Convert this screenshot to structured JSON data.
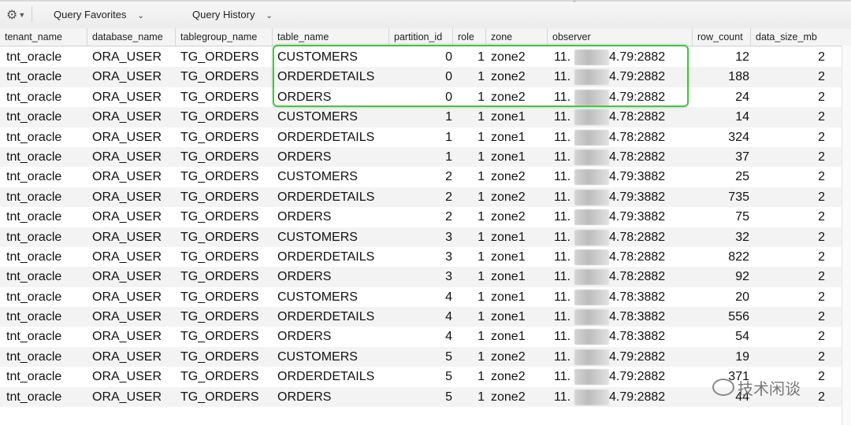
{
  "toolbar": {
    "query_favorites": "Query Favorites",
    "query_history": "Query History"
  },
  "columns": [
    "tenant_name",
    "database_name",
    "tablegroup_name",
    "table_name",
    "partition_id",
    "role",
    "zone",
    "observer",
    "row_count",
    "data_size_mb"
  ],
  "rows": [
    [
      "tnt_oracle",
      "ORA_USER",
      "TG_ORDERS",
      "CUSTOMERS",
      "0",
      "1",
      "zone2",
      "11.",
      "4.79:2882",
      "12",
      "2"
    ],
    [
      "tnt_oracle",
      "ORA_USER",
      "TG_ORDERS",
      "ORDERDETAILS",
      "0",
      "1",
      "zone2",
      "11.",
      "4.79:2882",
      "188",
      "2"
    ],
    [
      "tnt_oracle",
      "ORA_USER",
      "TG_ORDERS",
      "ORDERS",
      "0",
      "1",
      "zone2",
      "11.",
      "4.79:2882",
      "24",
      "2"
    ],
    [
      "tnt_oracle",
      "ORA_USER",
      "TG_ORDERS",
      "CUSTOMERS",
      "1",
      "1",
      "zone1",
      "11.",
      "4.78:2882",
      "14",
      "2"
    ],
    [
      "tnt_oracle",
      "ORA_USER",
      "TG_ORDERS",
      "ORDERDETAILS",
      "1",
      "1",
      "zone1",
      "11.",
      "4.78:2882",
      "324",
      "2"
    ],
    [
      "tnt_oracle",
      "ORA_USER",
      "TG_ORDERS",
      "ORDERS",
      "1",
      "1",
      "zone1",
      "11.",
      "4.78:2882",
      "37",
      "2"
    ],
    [
      "tnt_oracle",
      "ORA_USER",
      "TG_ORDERS",
      "CUSTOMERS",
      "2",
      "1",
      "zone2",
      "11.",
      "4.79:3882",
      "25",
      "2"
    ],
    [
      "tnt_oracle",
      "ORA_USER",
      "TG_ORDERS",
      "ORDERDETAILS",
      "2",
      "1",
      "zone2",
      "11.",
      "4.79:3882",
      "735",
      "2"
    ],
    [
      "tnt_oracle",
      "ORA_USER",
      "TG_ORDERS",
      "ORDERS",
      "2",
      "1",
      "zone2",
      "11.",
      "4.79:3882",
      "75",
      "2"
    ],
    [
      "tnt_oracle",
      "ORA_USER",
      "TG_ORDERS",
      "CUSTOMERS",
      "3",
      "1",
      "zone1",
      "11.",
      "4.78:2882",
      "32",
      "2"
    ],
    [
      "tnt_oracle",
      "ORA_USER",
      "TG_ORDERS",
      "ORDERDETAILS",
      "3",
      "1",
      "zone1",
      "11.",
      "4.78:2882",
      "822",
      "2"
    ],
    [
      "tnt_oracle",
      "ORA_USER",
      "TG_ORDERS",
      "ORDERS",
      "3",
      "1",
      "zone1",
      "11.",
      "4.78:2882",
      "92",
      "2"
    ],
    [
      "tnt_oracle",
      "ORA_USER",
      "TG_ORDERS",
      "CUSTOMERS",
      "4",
      "1",
      "zone1",
      "11.",
      "4.78:3882",
      "20",
      "2"
    ],
    [
      "tnt_oracle",
      "ORA_USER",
      "TG_ORDERS",
      "ORDERDETAILS",
      "4",
      "1",
      "zone1",
      "11.",
      "4.78:3882",
      "556",
      "2"
    ],
    [
      "tnt_oracle",
      "ORA_USER",
      "TG_ORDERS",
      "ORDERS",
      "4",
      "1",
      "zone1",
      "11.",
      "4.78:3882",
      "54",
      "2"
    ],
    [
      "tnt_oracle",
      "ORA_USER",
      "TG_ORDERS",
      "CUSTOMERS",
      "5",
      "1",
      "zone2",
      "11.",
      "4.79:2882",
      "19",
      "2"
    ],
    [
      "tnt_oracle",
      "ORA_USER",
      "TG_ORDERS",
      "ORDERDETAILS",
      "5",
      "1",
      "zone2",
      "11.",
      "4.79:2882",
      "371",
      "2"
    ],
    [
      "tnt_oracle",
      "ORA_USER",
      "TG_ORDERS",
      "ORDERS",
      "5",
      "1",
      "zone2",
      "11.",
      "4.79:2882",
      "44",
      "2"
    ]
  ],
  "watermark": "技术闲谈",
  "colors": {
    "highlight": "#4dc04a",
    "alt_row": "#f3f3f3"
  },
  "icons": {
    "settings": "gear-icon",
    "dropdown": "chevron-down-icon"
  }
}
